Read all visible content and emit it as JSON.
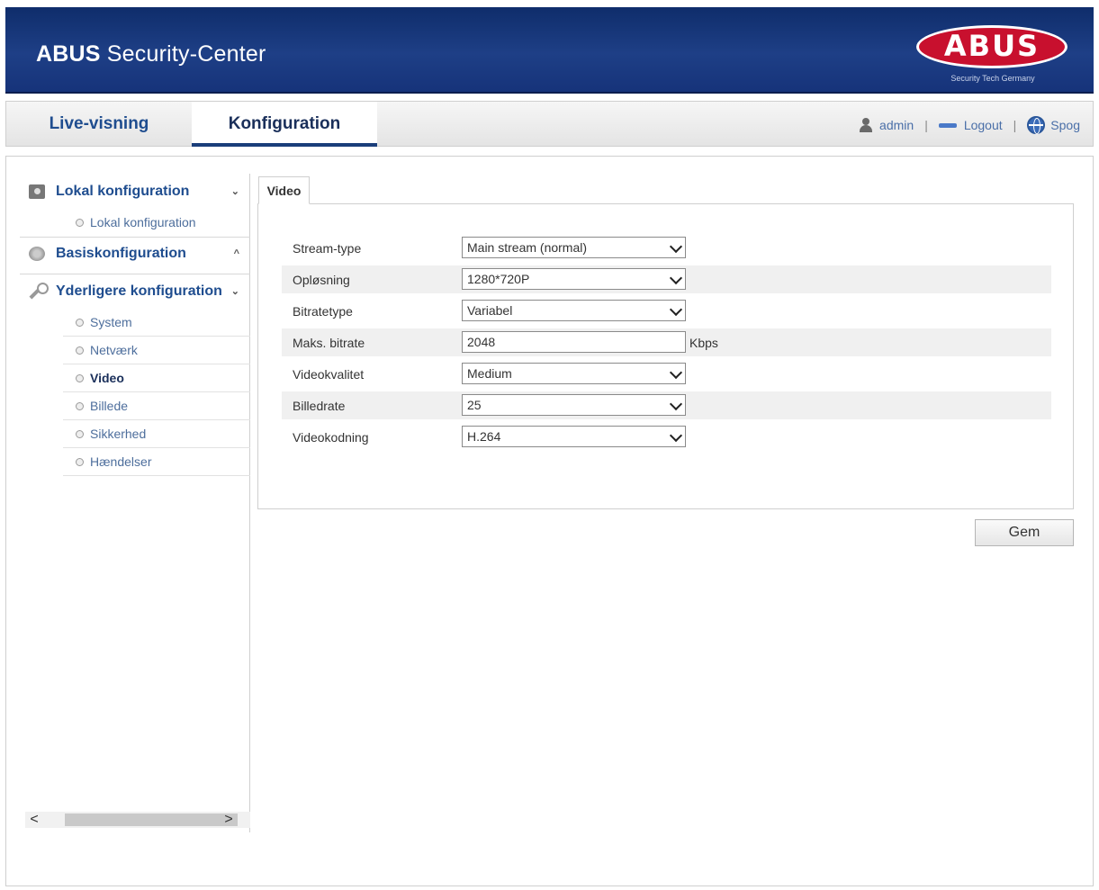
{
  "header": {
    "title_bold": "ABUS",
    "title_rest": "Security-Center",
    "logo_text": "ABUS",
    "logo_sub": "Security Tech Germany",
    "brand_color": "#c8102e",
    "banner_color": "#1e3f86"
  },
  "nav": {
    "tabs": [
      {
        "label": "Live-visning",
        "active": false
      },
      {
        "label": "Konfiguration",
        "active": true
      }
    ],
    "user": {
      "icon": "user-icon",
      "label": "admin"
    },
    "logout": {
      "icon": "logout-icon",
      "label": "Logout"
    },
    "language": {
      "icon": "globe-icon",
      "label": "Spog"
    },
    "separator": "|"
  },
  "sidebar": {
    "sections": [
      {
        "label": "Lokal konfiguration",
        "icon": "camera-icon",
        "chevron": "⌄",
        "items": [
          {
            "label": "Lokal konfiguration",
            "active": false
          }
        ]
      },
      {
        "label": "Basiskonfiguration",
        "icon": "disk-icon",
        "chevron": "^",
        "items": []
      },
      {
        "label": "Yderligere konfiguration",
        "icon": "wrench-icon",
        "chevron": "⌄",
        "items": [
          {
            "label": "System",
            "active": false
          },
          {
            "label": "Netværk",
            "active": false
          },
          {
            "label": "Video",
            "active": true
          },
          {
            "label": "Billede",
            "active": false
          },
          {
            "label": "Sikkerhed",
            "active": false
          },
          {
            "label": "Hændelser",
            "active": false
          }
        ]
      }
    ],
    "scroll": {
      "left_arrow": "<",
      "right_arrow": ">"
    }
  },
  "content": {
    "tab_label": "Video",
    "rows": [
      {
        "label": "Stream-type",
        "type": "select",
        "value": "Main stream (normal)"
      },
      {
        "label": "Opløsning",
        "type": "select",
        "value": "1280*720P"
      },
      {
        "label": "Bitratetype",
        "type": "select",
        "value": "Variabel"
      },
      {
        "label": "Maks. bitrate",
        "type": "text",
        "value": "2048",
        "unit": "Kbps"
      },
      {
        "label": "Videokvalitet",
        "type": "select",
        "value": "Medium"
      },
      {
        "label": "Billedrate",
        "type": "select",
        "value": "25"
      },
      {
        "label": "Videokodning",
        "type": "select",
        "value": "H.264"
      }
    ],
    "save_label": "Gem"
  }
}
